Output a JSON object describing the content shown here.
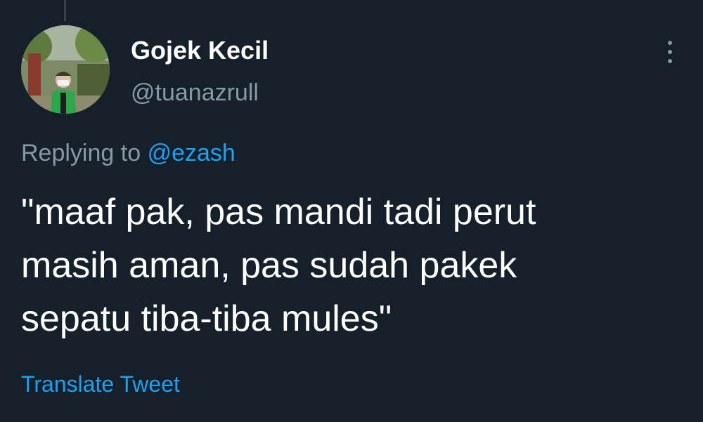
{
  "tweet": {
    "author": {
      "display_name": "Gojek Kecil",
      "handle": "@tuanazrull"
    },
    "replying_prefix": "Replying to",
    "replying_to": "@ezash",
    "text": "\"maaf pak, pas mandi tadi perut\nmasih aman, pas sudah pakek\nsepatu tiba-tiba mules\"",
    "translate_label": "Translate Tweet",
    "more_icon": "more-vertical-icon"
  },
  "colors": {
    "background": "#15202b",
    "primary_text": "#ffffff",
    "secondary_text": "#8899a6",
    "accent": "#1da1f2",
    "thread_line": "#38444d"
  }
}
